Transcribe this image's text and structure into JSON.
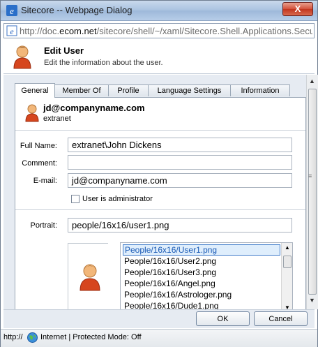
{
  "window": {
    "title": "Sitecore -- Webpage Dialog",
    "close_label": "X"
  },
  "address": {
    "url_prefix": "http://doc.",
    "url_domain": "ecom.net",
    "url_rest": "/sitecore/shell/~/xaml/Sitecore.Shell.Applications.Securit"
  },
  "header": {
    "title": "Edit User",
    "subtitle": "Edit the information about the user."
  },
  "tabs": [
    {
      "label": "General",
      "active": true
    },
    {
      "label": "Member Of",
      "active": false
    },
    {
      "label": "Profile",
      "active": false
    },
    {
      "label": "Language Settings",
      "active": false
    },
    {
      "label": "Information",
      "active": false
    }
  ],
  "user": {
    "name": "jd@companyname.com",
    "domain": "extranet"
  },
  "form": {
    "full_name_label": "Full Name:",
    "full_name_value": "extranet\\John Dickens",
    "comment_label": "Comment:",
    "comment_value": "",
    "email_label": "E-mail:",
    "email_value": "jd@companyname.com",
    "admin_label": "User is administrator",
    "admin_checked": false,
    "portrait_label": "Portrait:",
    "portrait_value": "people/16x16/user1.png"
  },
  "portrait_list": [
    "People/16x16/User1.png",
    "People/16x16/User2.png",
    "People/16x16/User3.png",
    "People/16x16/Angel.png",
    "People/16x16/Astrologer.png",
    "People/16x16/Dude1.png"
  ],
  "portrait_selected": "People/16x16/User1.png",
  "buttons": {
    "ok": "OK",
    "cancel": "Cancel"
  },
  "status": {
    "left": "http://",
    "zone": "Internet | Protected Mode: Off"
  }
}
